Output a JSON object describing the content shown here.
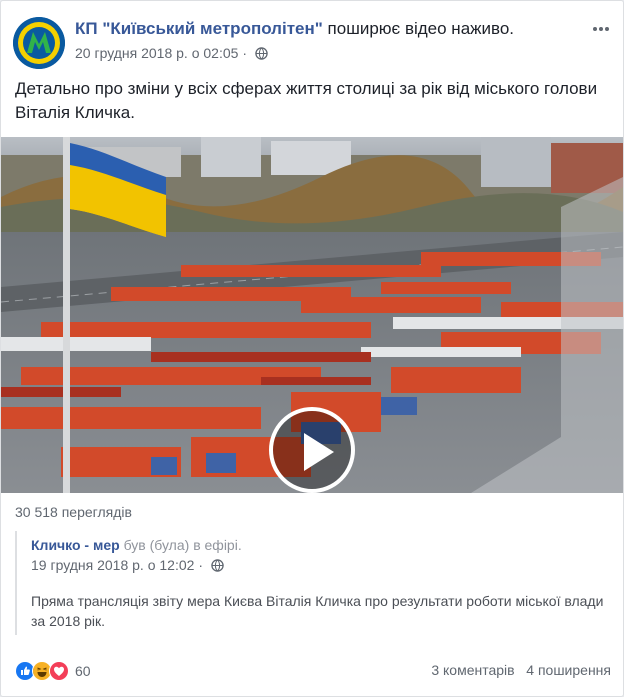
{
  "header": {
    "page_name": "КП \"Київський метрополітен\"",
    "action": "поширює відео наживо.",
    "date": "20 грудня 2018 р. о 02:05",
    "separator": "·"
  },
  "post": {
    "text": "Детально про зміни у всіх сферах життя столиці за рік від міського голови Віталія Кличка."
  },
  "video": {
    "views": "30 518 переглядів"
  },
  "shared": {
    "name": "Кличко - мер",
    "action": "був (була) в ефірі.",
    "date": "19 грудня 2018 р. о 12:02",
    "separator": "·",
    "text": "Пряма трансляція звіту мера Києва Віталія Кличка про результати роботи міської влади за 2018 рік."
  },
  "footer": {
    "reaction_count": "60",
    "comments": "3 коментарів",
    "shares": "4 поширення"
  },
  "colors": {
    "link": "#385898",
    "like": "#1877f2",
    "haha": "#f7b125",
    "love": "#f33e58",
    "metro_logo_bg": "#0a5aa0"
  },
  "icons": [
    "metro-logo",
    "globe-icon",
    "more-options-icon",
    "play-icon",
    "like-reaction-icon",
    "haha-reaction-icon",
    "love-reaction-icon"
  ]
}
